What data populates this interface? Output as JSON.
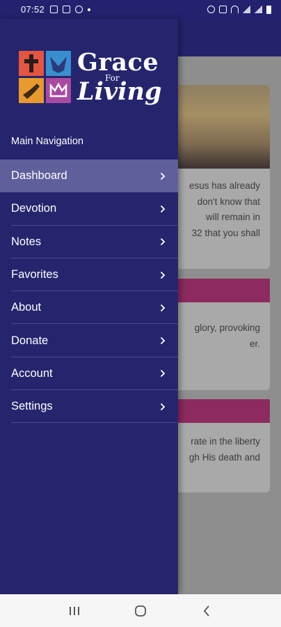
{
  "status_bar": {
    "time": "07:52"
  },
  "logo": {
    "word1": "Grace",
    "word2": "For",
    "word3": "Living"
  },
  "drawer": {
    "heading": "Main Navigation",
    "items": [
      {
        "label": "Dashboard",
        "active": true
      },
      {
        "label": "Devotion"
      },
      {
        "label": "Notes"
      },
      {
        "label": "Favorites"
      },
      {
        "label": "About"
      },
      {
        "label": "Donate"
      },
      {
        "label": "Account"
      },
      {
        "label": "Settings"
      }
    ]
  },
  "background": {
    "card1_lines": [
      "esus has already",
      "don't know that",
      "will remain in",
      "32 that you shall"
    ],
    "card2_lines": [
      "glory, provoking",
      "er."
    ],
    "card3_lines": [
      "rate in the liberty",
      "gh His death and"
    ]
  },
  "colors": {
    "primary": "#25256e",
    "active_item": "#5f5f9c",
    "accent_pink": "#8d2a5f"
  }
}
